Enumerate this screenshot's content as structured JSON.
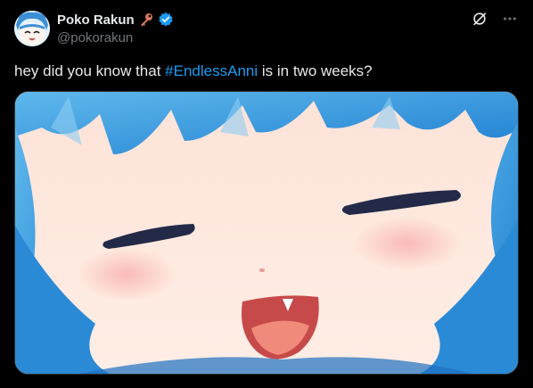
{
  "author": {
    "display_name": "Poko Rakun",
    "handle": "@pokorakun",
    "name_emoji": "key-emoji",
    "verified": true
  },
  "actions": {
    "grok_icon": "slash-circle-icon",
    "more_icon": "more-icon"
  },
  "tweet": {
    "text_before": "hey did you know that ",
    "hashtag": "#EndlessAnni",
    "text_after": " is in two weeks?"
  },
  "colors": {
    "accent": "#1d9bf0",
    "text_primary": "#e7e9ea",
    "text_secondary": "#71767b",
    "background": "#000000",
    "key_emoji": "#d4785a"
  }
}
